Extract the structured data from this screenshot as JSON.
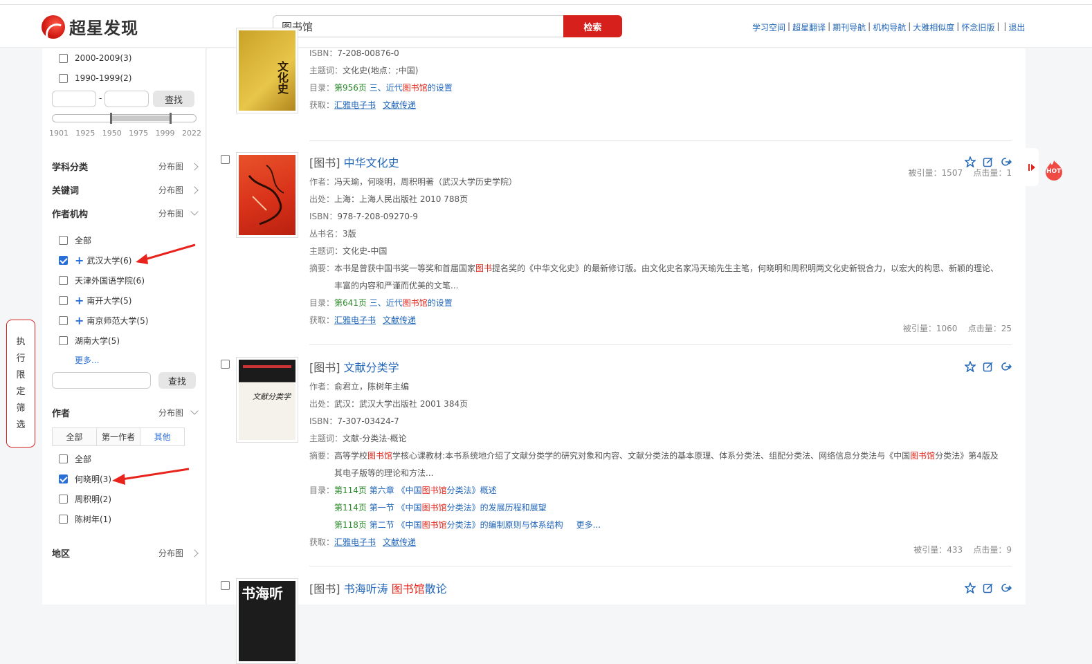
{
  "header": {
    "logo_text": "超星发现",
    "search_value": "图书馆",
    "search_button": "检索",
    "links": [
      "学习空间",
      "超星翻译",
      "期刊导航",
      "机构导航",
      "大雅相似度",
      "怀念旧版",
      "",
      "退出"
    ]
  },
  "sidebar": {
    "years": [
      {
        "label": "2000-2009(3)",
        "checked": false
      },
      {
        "label": "1990-1999(2)",
        "checked": false
      }
    ],
    "range_dash": "-",
    "find_label": "查找",
    "year_ticks": [
      "1901",
      "1925",
      "1950",
      "1975",
      "1999",
      "2022"
    ],
    "year_range": [
      1950,
      1999
    ],
    "sections": {
      "subject": "学科分类",
      "keyword": "关键词",
      "org": "作者机构",
      "author": "作者",
      "region": "地区",
      "dist": "分布图"
    },
    "orgs": [
      {
        "label": "全部",
        "checked": false,
        "plus": false
      },
      {
        "label": "武汉大学(6)",
        "checked": true,
        "plus": true
      },
      {
        "label": "天津外国语学院(6)",
        "checked": false,
        "plus": false
      },
      {
        "label": "南开大学(5)",
        "checked": false,
        "plus": true
      },
      {
        "label": "南京师范大学(5)",
        "checked": false,
        "plus": true
      },
      {
        "label": "湖南大学(5)",
        "checked": false,
        "plus": false
      }
    ],
    "more_label": "更多...",
    "author_tabs": [
      "全部",
      "第一作者",
      "其他"
    ],
    "authors": [
      {
        "label": "全部",
        "checked": false
      },
      {
        "label": "何晓明(3)",
        "checked": true
      },
      {
        "label": "周积明(2)",
        "checked": false
      },
      {
        "label": "陈树年(1)",
        "checked": false
      }
    ],
    "exec_filter_chars": [
      "执",
      "行",
      "限",
      "定",
      "筛",
      "选"
    ]
  },
  "results": [
    {
      "cover_text": "文化史",
      "isbn_label": "ISBN：",
      "isbn": "7-208-00876-0",
      "subject_label": "主题词：",
      "subject": "文化史(地点：;中国)",
      "toc_label": "目录：",
      "toc": [
        {
          "page": "第956页",
          "pre": "三、近代",
          "hl": "图书馆",
          "post": "的设置"
        }
      ],
      "get_label": "获取：",
      "get": [
        "汇雅电子书",
        "文献传递"
      ],
      "cited": "被引量：1507",
      "clicks": "点击量：1"
    },
    {
      "tag": "[图书]",
      "title": "中华文化史",
      "author_label": "作者：",
      "author": "冯天瑜，何晓明，周积明著（武汉大学历史学院）",
      "source_label": "出处：",
      "source": "上海：上海人民出版社 2010 788页",
      "isbn_label": "ISBN：",
      "isbn": "978-7-208-09270-9",
      "series_label": "丛书名：",
      "series": "3版",
      "subject_label": "主题词：",
      "subject": "文化史-中国",
      "abstract_label": "摘要：",
      "abstract_pre": "本书是曾获中国书奖一等奖和首届国家",
      "abstract_hl": "图书",
      "abstract_post": "提名奖的《中华文化史》的最新修订版。由文化史名家冯天瑜先生主笔，何晓明和周积明两文化史新锐合力，以宏大的构思、新颖的理论、",
      "abstract_line2": "丰富的内容和严谨而优美的文笔...",
      "toc_label": "目录：",
      "toc": [
        {
          "page": "第641页",
          "pre": "三、近代",
          "hl": "图书馆",
          "post": "的设置"
        }
      ],
      "get_label": "获取：",
      "get": [
        "汇雅电子书",
        "文献传递"
      ],
      "cited": "被引量：1060",
      "clicks": "点击量：25"
    },
    {
      "tag": "[图书]",
      "title": "文献分类学",
      "author_label": "作者：",
      "author": "俞君立，陈树年主编",
      "source_label": "出处：",
      "source": "武汉：武汉大学出版社 2001 384页",
      "isbn_label": "ISBN：",
      "isbn": "7-307-03424-7",
      "subject_label": "主题词：",
      "subject": "文献-分类法-概论",
      "abstract_label": "摘要：",
      "abstract_pre": "高等学校",
      "abstract_hl": "图书馆",
      "abstract_post": "学核心课教材:本书系统地介绍了文献分类学的研究对象和内容、文献分类法的基本原理、体系分类法、组配分类法、网络信息分类法与《中国",
      "abstract_hl2": "图书馆",
      "abstract_post2": "分类法》第4版及",
      "abstract_line2": "其电子版等的理论和方法...",
      "toc_label": "目录：",
      "toc": [
        {
          "page": "第114页",
          "pre": "第六章 《中国",
          "hl": "图书馆",
          "post": "分类法》概述"
        },
        {
          "page": "第114页",
          "pre": "第一节 《中国",
          "hl": "图书馆",
          "post": "分类法》的发展历程和展望"
        },
        {
          "page": "第118页",
          "pre": "第二节 《中国",
          "hl": "图书馆",
          "post": "分类法》的编制原则与体系结构"
        }
      ],
      "toc_more": "更多...",
      "get_label": "获取：",
      "get": [
        "汇雅电子书",
        "文献传递"
      ],
      "cited": "被引量：433",
      "clicks": "点击量：9"
    },
    {
      "tag": "[图书]",
      "title_pre": "书海听涛 ",
      "title_hl": "图书馆",
      "title_post": "散论",
      "cover_text": "书海听"
    }
  ],
  "hot_label": "HOT",
  "colors": {
    "brand_red": "#d6201b",
    "link_blue": "#2266b8",
    "highlight": "#e0251a",
    "toc_green": "#2b8a2b"
  }
}
